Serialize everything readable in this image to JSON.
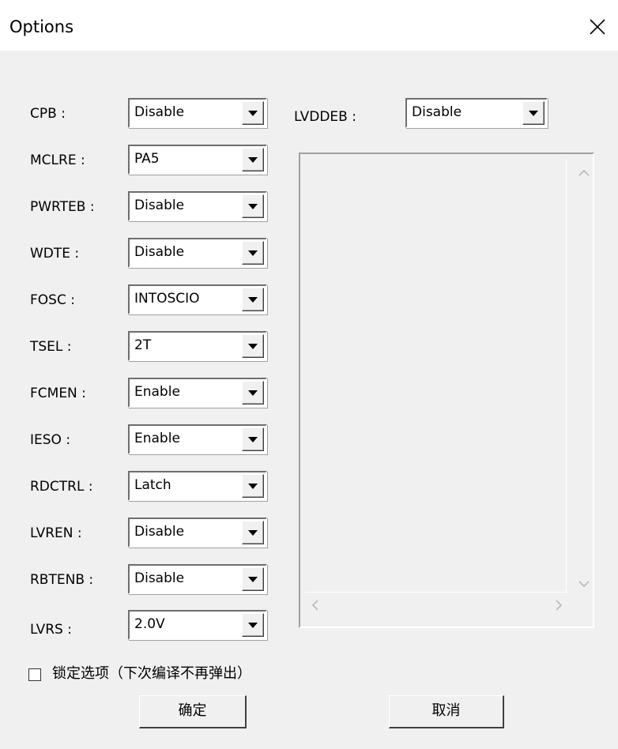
{
  "window": {
    "title": "Options",
    "close_icon": "close-icon"
  },
  "left_options": [
    {
      "label": "CPB :",
      "value": "Disable"
    },
    {
      "label": "MCLRE :",
      "value": "PA5"
    },
    {
      "label": "PWRTEB :",
      "value": "Disable"
    },
    {
      "label": "WDTE :",
      "value": "Disable"
    },
    {
      "label": "FOSC :",
      "value": "INTOSCIO"
    },
    {
      "label": "TSEL :",
      "value": "2T"
    },
    {
      "label": "FCMEN :",
      "value": "Enable"
    },
    {
      "label": "IESO :",
      "value": "Enable"
    },
    {
      "label": "RDCTRL :",
      "value": "Latch"
    },
    {
      "label": "LVREN :",
      "value": "Disable"
    },
    {
      "label": "RBTENB :",
      "value": "Disable"
    },
    {
      "label": "LVRS :",
      "value": "2.0V"
    }
  ],
  "right_option": {
    "label": "LVDDEB :",
    "value": "Disable"
  },
  "lock_option": {
    "label": "锁定选项（下次编译不再弹出）",
    "checked": false
  },
  "buttons": {
    "ok": "确定",
    "cancel": "取消"
  }
}
